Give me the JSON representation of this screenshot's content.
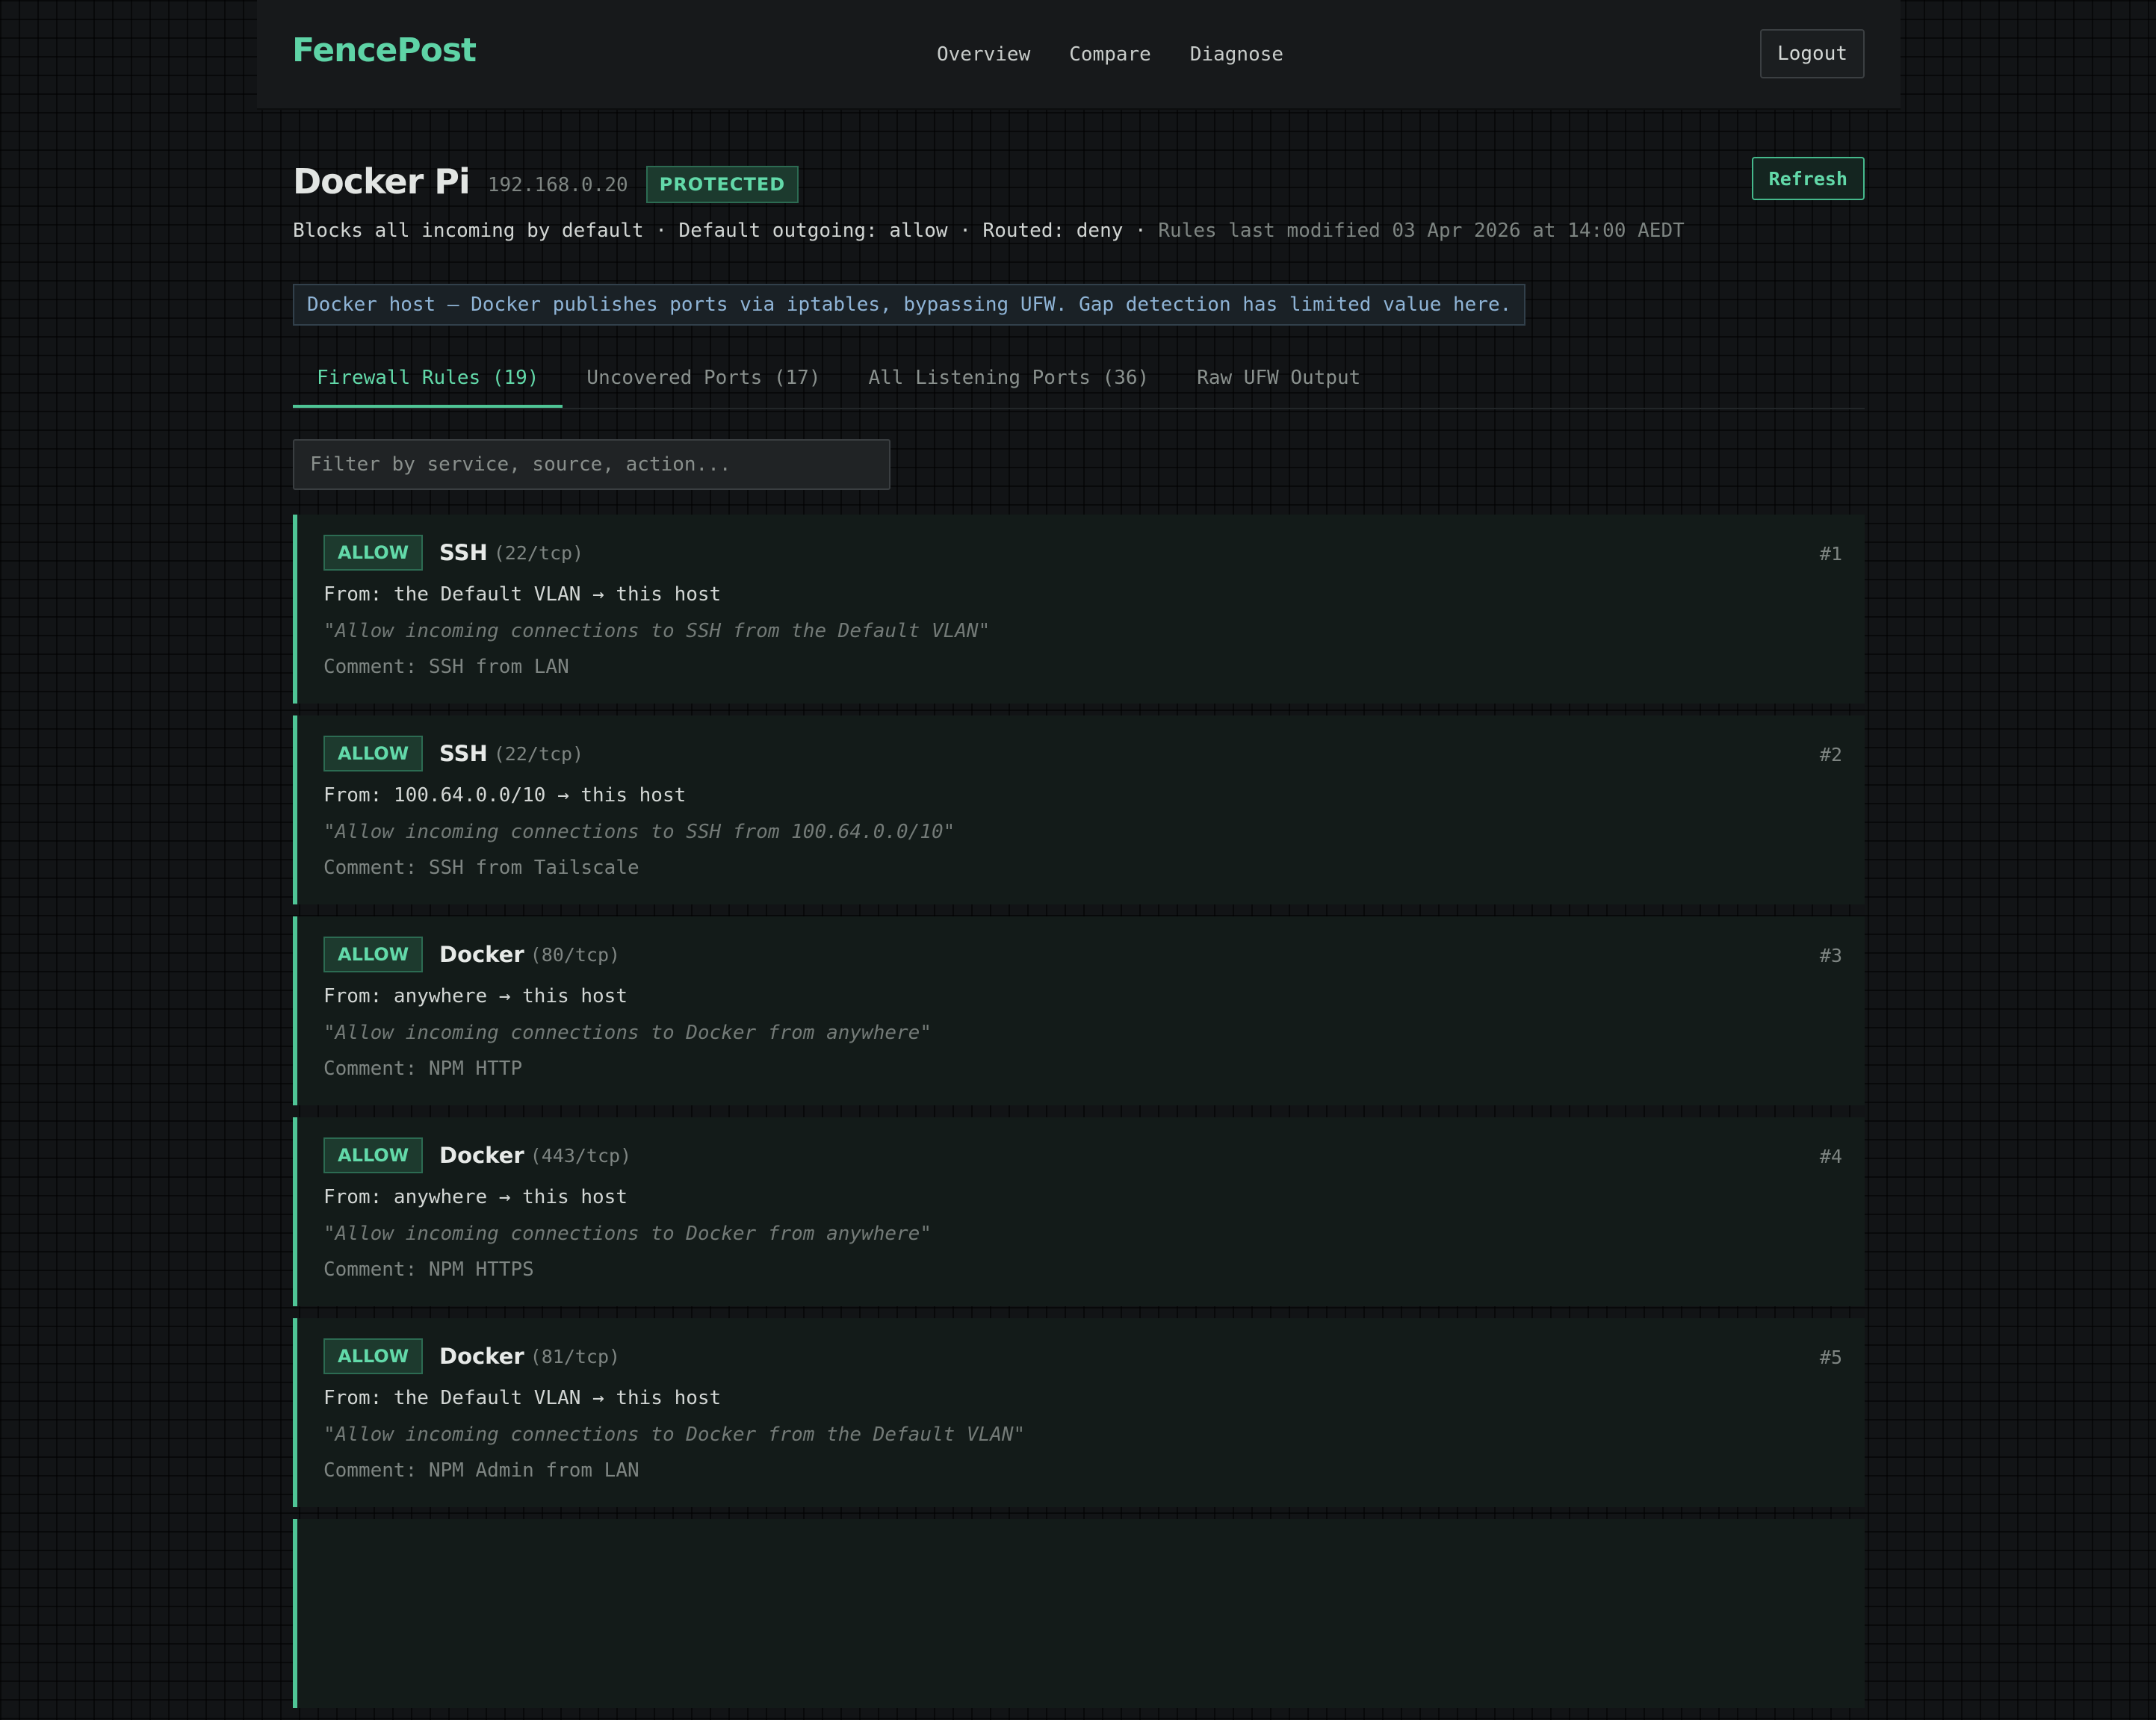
{
  "app": {
    "brand": "FencePost",
    "nav": [
      "Overview",
      "Compare",
      "Diagnose"
    ],
    "logout_label": "Logout"
  },
  "host": {
    "name": "Docker Pi",
    "ip": "192.168.0.20",
    "status": "PROTECTED",
    "refresh_label": "Refresh",
    "summary_main": "Blocks all incoming by default · Default outgoing: allow · Routed: deny ·",
    "summary_modified": "Rules last modified 03 Apr 2026 at 14:00 AEDT",
    "notice": "Docker host — Docker publishes ports via iptables, bypassing UFW. Gap detection has limited value here."
  },
  "tabs": [
    {
      "label": "Firewall Rules (19)",
      "active": true
    },
    {
      "label": "Uncovered Ports (17)",
      "active": false
    },
    {
      "label": "All Listening Ports (36)",
      "active": false
    },
    {
      "label": "Raw UFW Output",
      "active": false
    }
  ],
  "filter": {
    "placeholder": "Filter by service, source, action...",
    "value": ""
  },
  "colors": {
    "accent": "#5ed3a6",
    "allow_border": "#4fc596",
    "notice_text": "#8fb4d6"
  },
  "rules": [
    {
      "action": "ALLOW",
      "service": "SSH",
      "port": "(22/tcp)",
      "number": "#1",
      "from": "From: the Default VLAN → this host",
      "description": "\"Allow incoming connections to SSH from the Default VLAN\"",
      "comment": "Comment: SSH from LAN"
    },
    {
      "action": "ALLOW",
      "service": "SSH",
      "port": "(22/tcp)",
      "number": "#2",
      "from": "From: 100.64.0.0/10 → this host",
      "description": "\"Allow incoming connections to SSH from 100.64.0.0/10\"",
      "comment": "Comment: SSH from Tailscale"
    },
    {
      "action": "ALLOW",
      "service": "Docker",
      "port": "(80/tcp)",
      "number": "#3",
      "from": "From: anywhere → this host",
      "description": "\"Allow incoming connections to Docker from anywhere\"",
      "comment": "Comment: NPM HTTP"
    },
    {
      "action": "ALLOW",
      "service": "Docker",
      "port": "(443/tcp)",
      "number": "#4",
      "from": "From: anywhere → this host",
      "description": "\"Allow incoming connections to Docker from anywhere\"",
      "comment": "Comment: NPM HTTPS"
    },
    {
      "action": "ALLOW",
      "service": "Docker",
      "port": "(81/tcp)",
      "number": "#5",
      "from": "From: the Default VLAN → this host",
      "description": "\"Allow incoming connections to Docker from the Default VLAN\"",
      "comment": "Comment: NPM Admin from LAN"
    }
  ]
}
